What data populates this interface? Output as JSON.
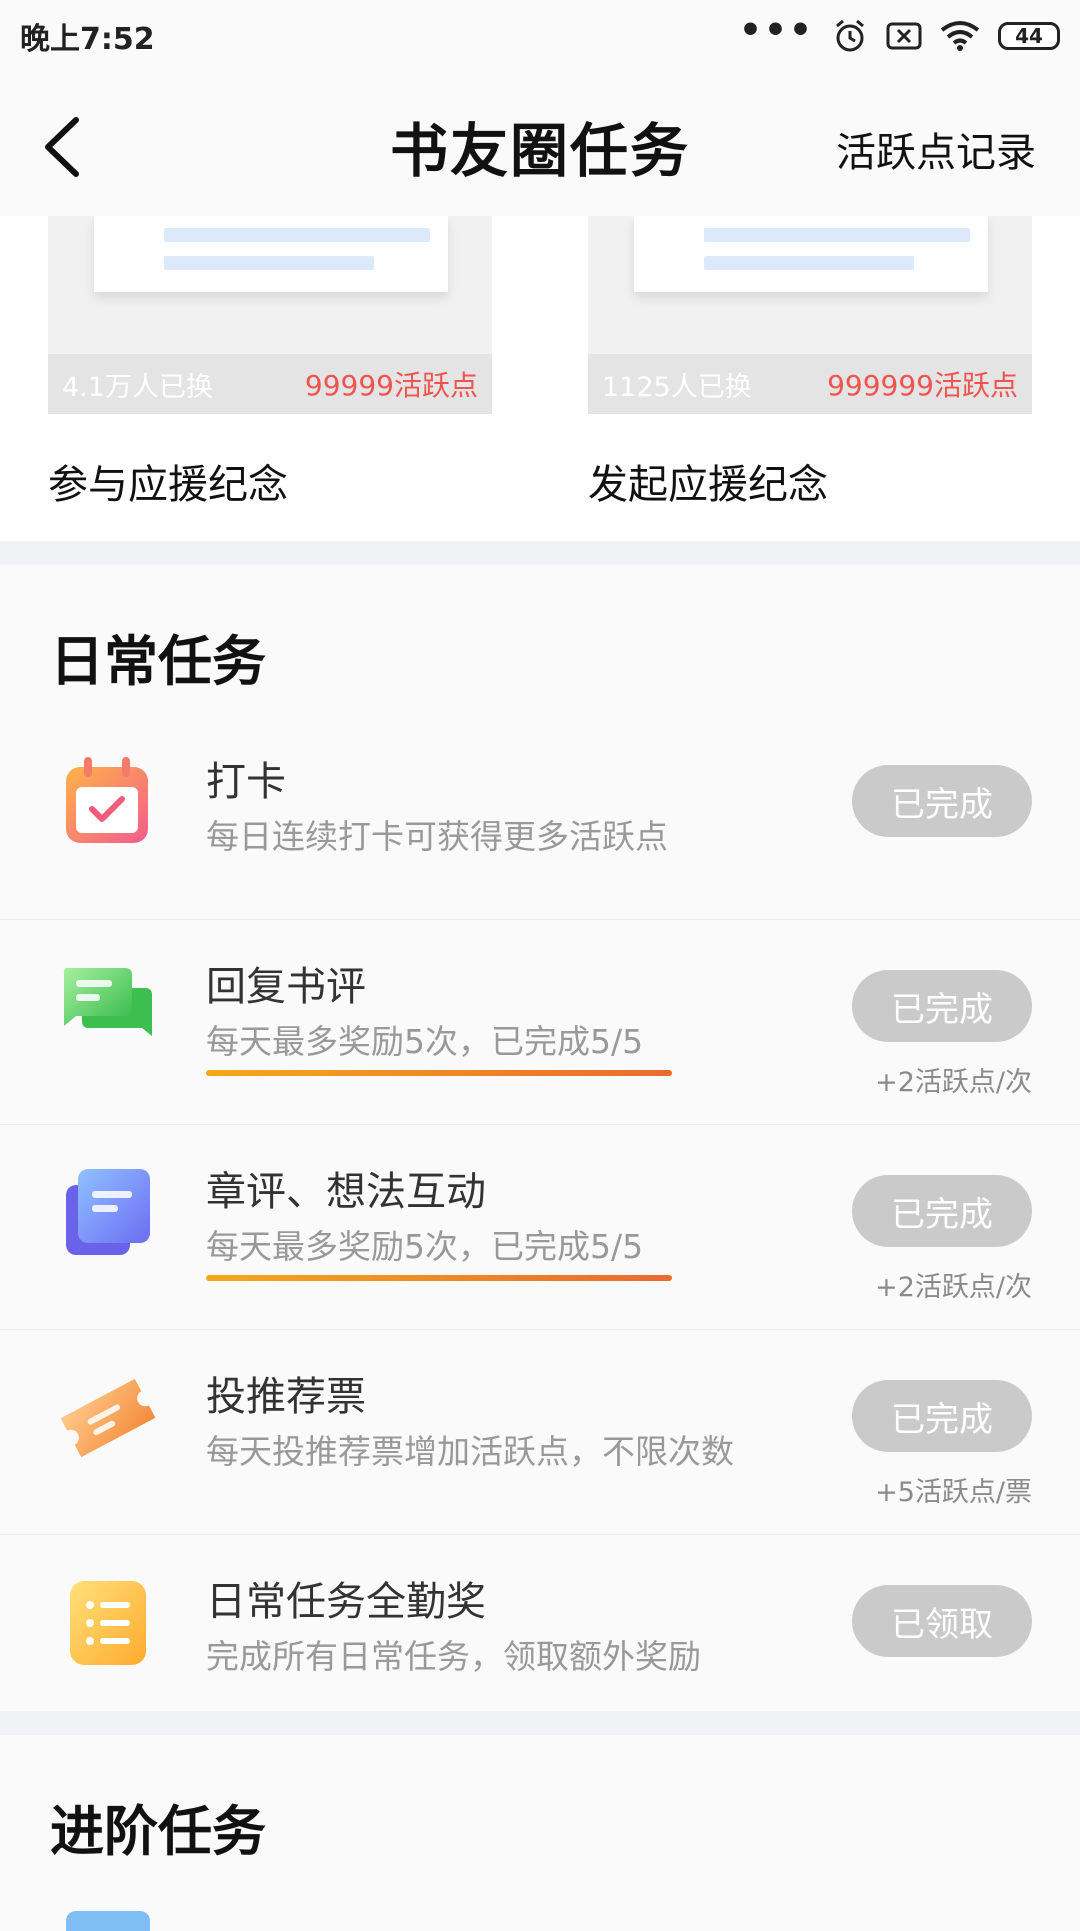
{
  "status_bar": {
    "time": "晚上7:52",
    "dots": "•••",
    "battery": "44"
  },
  "nav": {
    "title": "书友圈任务",
    "right_link": "活跃点记录"
  },
  "souvenirs": [
    {
      "count": "4.1万人已换",
      "points": "99999活跃点",
      "name": "参与应援纪念"
    },
    {
      "count": "1125人已换",
      "points": "999999活跃点",
      "name": "发起应援纪念"
    }
  ],
  "daily": {
    "title": "日常任务",
    "tasks": [
      {
        "name": "打卡",
        "desc": "每日连续打卡可获得更多活跃点",
        "button": "已完成",
        "reward": "",
        "icon": "calendar-check-icon"
      },
      {
        "name": "回复书评",
        "desc": "每天最多奖励5次，已完成5/5",
        "button": "已完成",
        "reward": "+2活跃点/次",
        "icon": "chat-bubbles-icon"
      },
      {
        "name": "章评、想法互动",
        "desc": "每天最多奖励5次，已完成5/5",
        "button": "已完成",
        "reward": "+2活跃点/次",
        "icon": "document-icon"
      },
      {
        "name": "投推荐票",
        "desc": "每天投推荐票增加活跃点，不限次数",
        "button": "已完成",
        "reward": "+5活跃点/票",
        "icon": "ticket-icon"
      },
      {
        "name": "日常任务全勤奖",
        "desc": "完成所有日常任务，领取额外奖励",
        "button": "已领取",
        "reward": "",
        "icon": "list-icon"
      }
    ]
  },
  "advanced": {
    "title": "进阶任务"
  },
  "colors": {
    "accent_red": "#f0544f",
    "button_gray": "#cacaca",
    "underline_start": "#f3a91c",
    "underline_end": "#ea6a2f"
  }
}
